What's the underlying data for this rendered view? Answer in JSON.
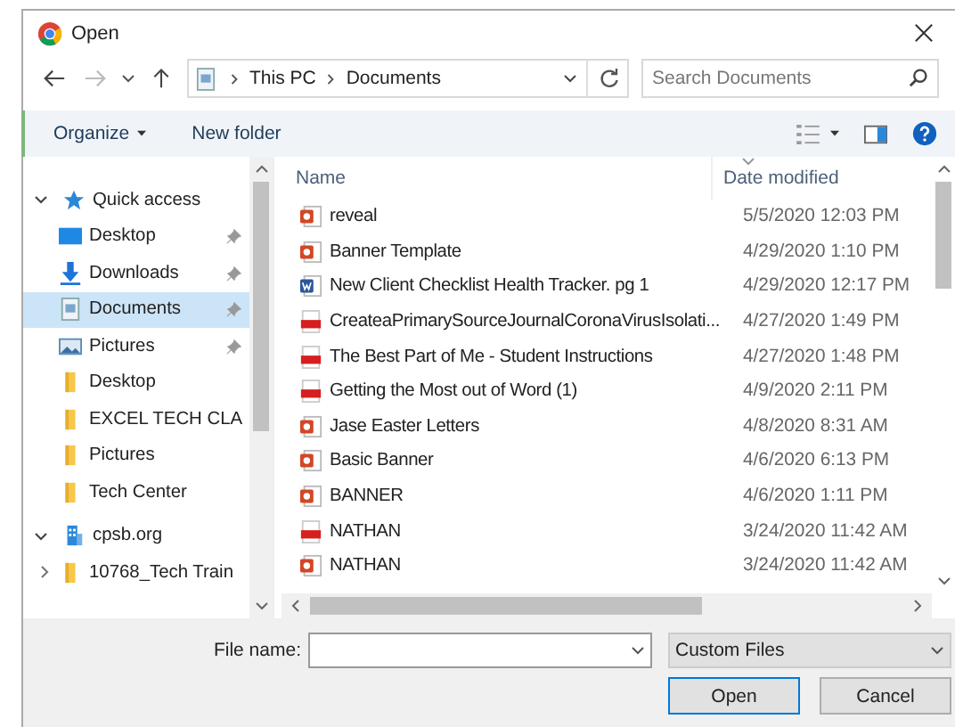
{
  "window": {
    "title": "Open"
  },
  "address": {
    "path": [
      "This PC",
      "Documents"
    ]
  },
  "search": {
    "placeholder": "Search Documents"
  },
  "toolbar": {
    "organize": "Organize",
    "new_folder": "New folder"
  },
  "sidebar": {
    "items": [
      {
        "label": "Quick access",
        "kind": "star",
        "expanded": true,
        "selected": false,
        "children": [
          {
            "label": "Desktop",
            "kind": "desktop",
            "pinned": true,
            "selected": false
          },
          {
            "label": "Downloads",
            "kind": "downloads",
            "pinned": true,
            "selected": false
          },
          {
            "label": "Documents",
            "kind": "documents",
            "pinned": true,
            "selected": true
          },
          {
            "label": "Pictures",
            "kind": "pictures",
            "pinned": true,
            "selected": false
          },
          {
            "label": "Desktop",
            "kind": "folder",
            "pinned": false,
            "selected": false
          },
          {
            "label": "EXCEL TECH CLA",
            "kind": "folder",
            "pinned": false,
            "selected": false
          },
          {
            "label": "Pictures",
            "kind": "folder",
            "pinned": false,
            "selected": false
          },
          {
            "label": "Tech Center",
            "kind": "folder",
            "pinned": false,
            "selected": false
          }
        ]
      },
      {
        "label": "cpsb.org",
        "kind": "network",
        "expanded": true,
        "selected": false,
        "children": [
          {
            "label": "10768_Tech Train",
            "kind": "folder",
            "expanded": false,
            "pinned": false,
            "selected": false
          }
        ]
      }
    ]
  },
  "table": {
    "columns": [
      "Name",
      "Date modified"
    ],
    "rows": [
      {
        "name": "reveal",
        "date": "5/5/2020 12:03 PM",
        "kind": "ppt"
      },
      {
        "name": "Banner Template",
        "date": "4/29/2020 1:10 PM",
        "kind": "ppt"
      },
      {
        "name": "New Client Checklist Health Tracker. pg 1",
        "date": "4/29/2020 12:17 PM",
        "kind": "word"
      },
      {
        "name": "CreateaPrimarySourceJournalCoronaVirusIsolati...",
        "date": "4/27/2020 1:49 PM",
        "kind": "pdf"
      },
      {
        "name": "The Best Part of Me - Student Instructions",
        "date": "4/27/2020 1:48 PM",
        "kind": "pdf"
      },
      {
        "name": "Getting the Most out of Word (1)",
        "date": "4/9/2020 2:11 PM",
        "kind": "pdf"
      },
      {
        "name": "Jase Easter Letters",
        "date": "4/8/2020 8:31 AM",
        "kind": "ppt"
      },
      {
        "name": "Basic Banner",
        "date": "4/6/2020 6:13 PM",
        "kind": "ppt"
      },
      {
        "name": "BANNER",
        "date": "4/6/2020 1:11 PM",
        "kind": "ppt"
      },
      {
        "name": "NATHAN",
        "date": "3/24/2020 11:42 AM",
        "kind": "pdf"
      },
      {
        "name": "NATHAN",
        "date": "3/24/2020 11:42 AM",
        "kind": "ppt"
      }
    ]
  },
  "footer": {
    "file_name_label": "File name:",
    "file_type": "Custom Files",
    "buttons": [
      "Open",
      "Cancel"
    ]
  }
}
